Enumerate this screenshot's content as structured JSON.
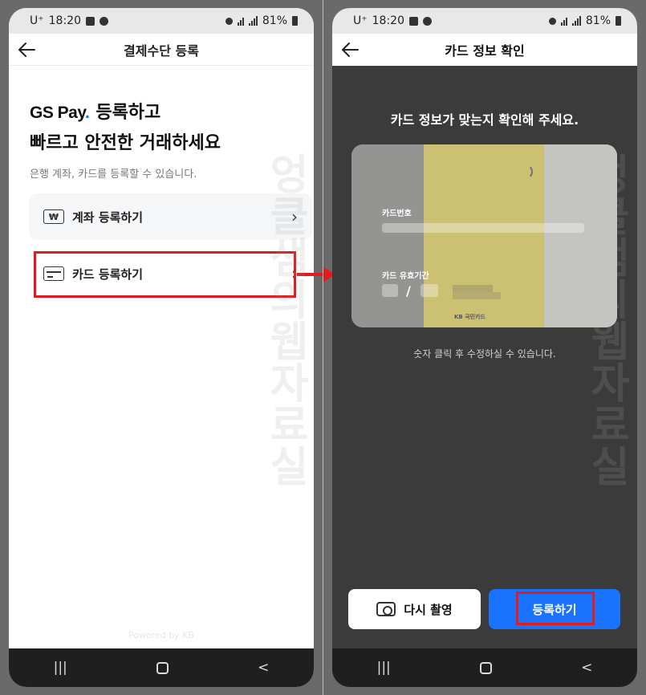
{
  "status_bar": {
    "carrier": "U⁺",
    "time": "18:20",
    "battery": "81%"
  },
  "left_screen": {
    "title": "결제수단 등록",
    "brand": {
      "logo_text": "GS Pay",
      "logo_dot": ".",
      "headline_suffix": "등록하고"
    },
    "headline2": "빠르고 안전한 거래하세요",
    "subtext": "은행 계좌, 카드를 등록할 수 있습니다.",
    "options": [
      {
        "label": "계좌 등록하기",
        "icon": "won-icon"
      },
      {
        "label": "카드 등록하기",
        "icon": "credit-card-icon"
      }
    ],
    "footer": "Powered by KB"
  },
  "right_screen": {
    "title": "카드 정보 확인",
    "prompt": "카드 정보가 맞는지 확인해 주세요.",
    "card": {
      "number_label": "카드번호",
      "expiry_label": "카드 유효기간",
      "expiry_separator": "/",
      "issuer": "KB 국민카드"
    },
    "hint": "숫자 클릭 후 수정하실 수 있습니다.",
    "buttons": {
      "retake": "다시 촬영",
      "register": "등록하기"
    }
  },
  "navbar": {
    "recents": "|||",
    "back": "<"
  },
  "watermark": "엉클샘의웹자료실",
  "colors": {
    "accent_blue": "#1a73ff",
    "highlight_red": "#e31b1b",
    "dark_bg": "#3b3b3b"
  }
}
